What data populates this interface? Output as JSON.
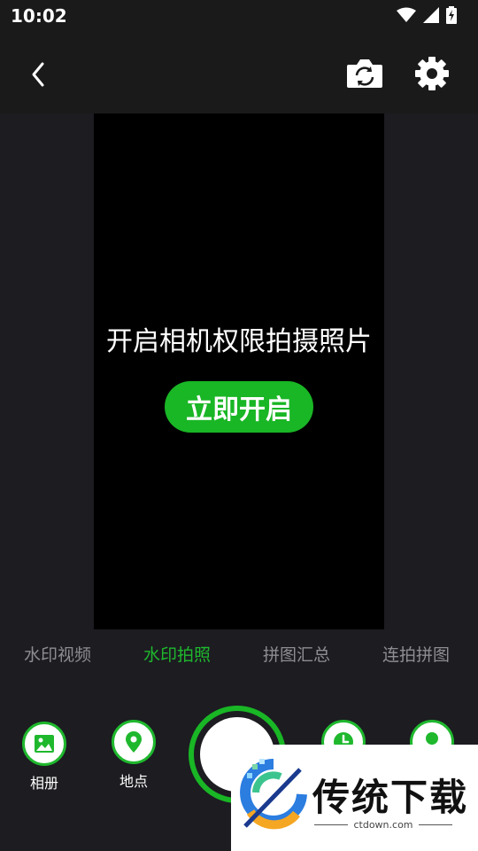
{
  "status_bar": {
    "time": "10:02"
  },
  "preview": {
    "permission_text": "开启相机权限拍摄照片",
    "enable_button": "立即开启"
  },
  "modes": [
    {
      "label": "水印视频",
      "active": false
    },
    {
      "label": "水印拍照",
      "active": true
    },
    {
      "label": "拼图汇总",
      "active": false
    },
    {
      "label": "连拍拼图",
      "active": false
    }
  ],
  "bottom": {
    "album_label": "相册",
    "location_label": "地点"
  },
  "watermark": {
    "title": "传统下载",
    "url": "ctdown.com"
  },
  "colors": {
    "accent": "#19b625",
    "background": "#1c1c21",
    "bar": "#1a1a1a"
  }
}
